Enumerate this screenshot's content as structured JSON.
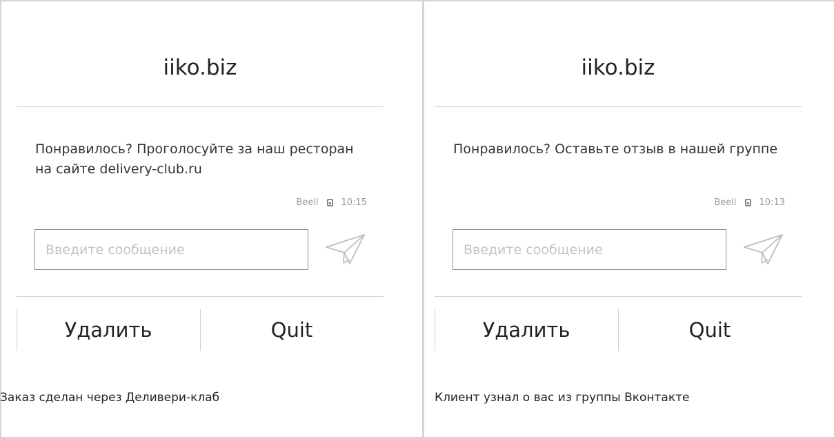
{
  "panels": [
    {
      "title": "iiko.biz",
      "message": "Понравилось? Проголосуйте за наш ресторан на сайте delivery-club.ru",
      "sender": "Beeli",
      "time": "10:15",
      "input_placeholder": "Введите сообщение",
      "delete_label": "Удалить",
      "quit_label": "Quit",
      "caption": "Заказ сделан через Деливери-клаб",
      "icons": {
        "device": "device-icon",
        "send": "send-icon"
      }
    },
    {
      "title": "iiko.biz",
      "message": "Понравилось? Оставьте отзыв в нашей группе",
      "sender": "Beeli",
      "time": "10:13",
      "input_placeholder": "Введите сообщение",
      "delete_label": "Удалить",
      "quit_label": "Quit",
      "caption": "Клиент узнал о вас из группы Вконтакте",
      "icons": {
        "device": "device-icon",
        "send": "send-icon"
      }
    }
  ],
  "colors": {
    "border": "#d4d4d4",
    "text": "#222222",
    "muted": "#9a9a9a",
    "placeholder": "#c3c3c3",
    "send_icon": "#bdbdbd"
  }
}
